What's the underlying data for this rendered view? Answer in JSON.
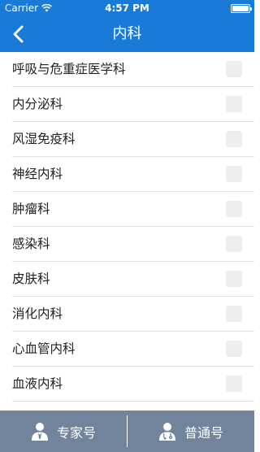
{
  "status_bar": {
    "carrier": "Carrier",
    "time": "4:57 PM"
  },
  "nav": {
    "title": "内科",
    "back_icon": "chevron-left-icon"
  },
  "departments": [
    {
      "label": "呼吸与危重症医学科",
      "checked": false
    },
    {
      "label": "内分泌科",
      "checked": false
    },
    {
      "label": "风湿免疫科",
      "checked": false
    },
    {
      "label": "神经内科",
      "checked": false
    },
    {
      "label": "肿瘤科",
      "checked": false
    },
    {
      "label": "感染科",
      "checked": false
    },
    {
      "label": "皮肤科",
      "checked": false
    },
    {
      "label": "消化内科",
      "checked": false
    },
    {
      "label": "心血管内科",
      "checked": false
    },
    {
      "label": "血液内科",
      "checked": false
    }
  ],
  "tabs": [
    {
      "label": "专家号",
      "icon": "expert-doctor-icon"
    },
    {
      "label": "普通号",
      "icon": "general-doctor-icon"
    }
  ],
  "colors": {
    "brand_blue": "#1a7ad7",
    "tab_bar": "#71849c"
  }
}
